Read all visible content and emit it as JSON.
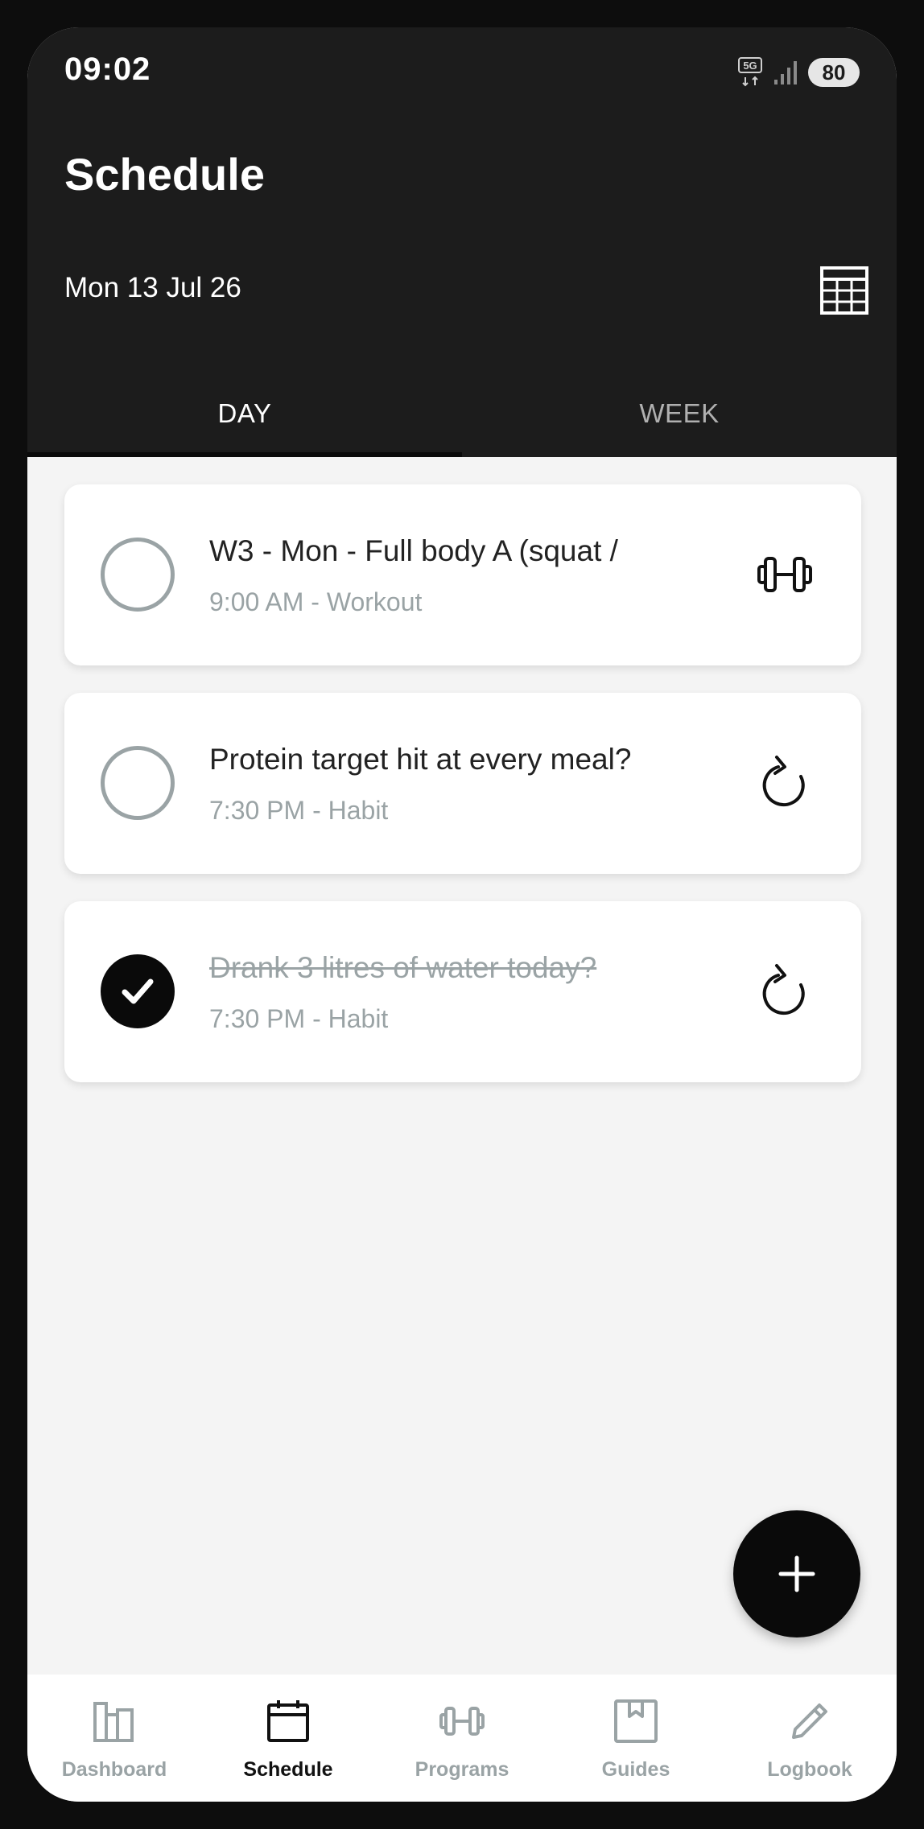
{
  "status_bar": {
    "time": "09:02",
    "network": "5G",
    "battery": "80"
  },
  "header": {
    "title": "Schedule",
    "date": "Mon 13 Jul 26",
    "calendar_icon": "calendar-grid-icon"
  },
  "tabs": [
    {
      "label": "DAY",
      "active": true
    },
    {
      "label": "WEEK",
      "active": false
    }
  ],
  "tasks": [
    {
      "title": "W3 - Mon - Full body A (squat /",
      "subtitle": "9:00 AM - Workout",
      "done": false,
      "icon": "dumbbell-icon"
    },
    {
      "title": "Protein target hit at every meal?",
      "subtitle": "7:30 PM - Habit",
      "done": false,
      "icon": "repeat-icon"
    },
    {
      "title": "Drank 3 litres of water today?",
      "subtitle": "7:30 PM - Habit",
      "done": true,
      "icon": "repeat-icon"
    }
  ],
  "fab": {
    "icon": "plus-icon"
  },
  "bottom_nav": [
    {
      "label": "Dashboard",
      "icon": "dashboard-icon",
      "active": false
    },
    {
      "label": "Schedule",
      "icon": "calendar-icon",
      "active": true
    },
    {
      "label": "Programs",
      "icon": "dumbbell-icon",
      "active": false
    },
    {
      "label": "Guides",
      "icon": "guides-icon",
      "active": false
    },
    {
      "label": "Logbook",
      "icon": "pencil-icon",
      "active": false
    }
  ],
  "colors": {
    "header_bg": "#1c1c1c",
    "content_bg": "#f4f4f4",
    "accent": "#0a0a0a",
    "muted": "#9aa3a5"
  }
}
